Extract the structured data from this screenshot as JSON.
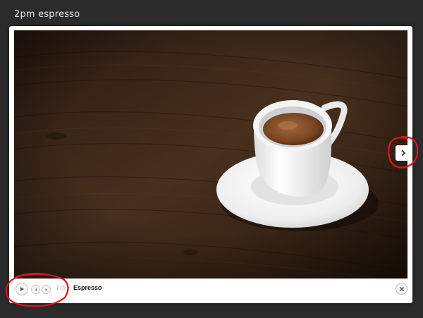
{
  "page": {
    "title": "2pm espresso"
  },
  "lightbox": {
    "photo_subject": "espresso-cup-on-saucer",
    "counter": "1/5",
    "caption": "Espresso",
    "icons": {
      "play": "play-icon",
      "prev": "previous-icon",
      "next_small": "next-icon",
      "next_large": "chevron-right-icon",
      "close": "close-icon"
    }
  },
  "colors": {
    "background": "#2b2b2b",
    "annotation": "#e0121b",
    "wood": "#3a2417"
  }
}
